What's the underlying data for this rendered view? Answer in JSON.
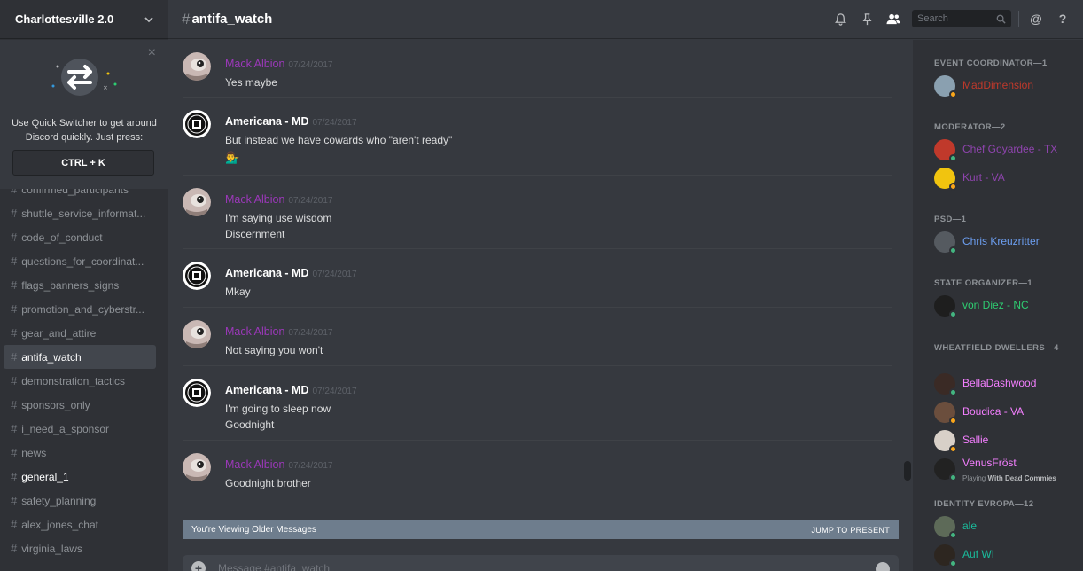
{
  "server": {
    "name": "Charlottesville 2.0"
  },
  "quick_switcher": {
    "text": "Use Quick Switcher to get around Discord quickly. Just press:",
    "shortcut": "CTRL + K"
  },
  "channels": [
    {
      "name": "confirmed_participants",
      "active": false,
      "unread": false
    },
    {
      "name": "shuttle_service_informat...",
      "active": false,
      "unread": false
    },
    {
      "name": "code_of_conduct",
      "active": false,
      "unread": false
    },
    {
      "name": "questions_for_coordinat...",
      "active": false,
      "unread": false
    },
    {
      "name": "flags_banners_signs",
      "active": false,
      "unread": false
    },
    {
      "name": "promotion_and_cyberstr...",
      "active": false,
      "unread": false
    },
    {
      "name": "gear_and_attire",
      "active": false,
      "unread": false
    },
    {
      "name": "antifa_watch",
      "active": true,
      "unread": false
    },
    {
      "name": "demonstration_tactics",
      "active": false,
      "unread": false
    },
    {
      "name": "sponsors_only",
      "active": false,
      "unread": false
    },
    {
      "name": "i_need_a_sponsor",
      "active": false,
      "unread": false
    },
    {
      "name": "news",
      "active": false,
      "unread": false
    },
    {
      "name": "general_1",
      "active": false,
      "unread": true
    },
    {
      "name": "safety_planning",
      "active": false,
      "unread": false
    },
    {
      "name": "alex_jones_chat",
      "active": false,
      "unread": false
    },
    {
      "name": "virginia_laws",
      "active": false,
      "unread": false
    }
  ],
  "channel_header": {
    "hash": "#",
    "name": "antifa_watch"
  },
  "search": {
    "placeholder": "Search"
  },
  "messages": [
    {
      "author": "Mack Albion",
      "author_color": "purple",
      "timestamp": "07/24/2017",
      "avatar": "mack",
      "lines": [
        "Yes maybe"
      ]
    },
    {
      "author": "Americana - MD",
      "author_color": "white",
      "timestamp": "07/24/2017",
      "avatar": "americana",
      "lines": [
        "But instead we have cowards who \"aren't ready\""
      ],
      "emoji": "💁‍♂"
    },
    {
      "author": "Mack Albion",
      "author_color": "purple",
      "timestamp": "07/24/2017",
      "avatar": "mack",
      "lines": [
        "I'm saying use wisdom",
        "Discernment"
      ]
    },
    {
      "author": "Americana - MD",
      "author_color": "white",
      "timestamp": "07/24/2017",
      "avatar": "americana",
      "lines": [
        "Mkay"
      ]
    },
    {
      "author": "Mack Albion",
      "author_color": "purple",
      "timestamp": "07/24/2017",
      "avatar": "mack",
      "lines": [
        "Not saying you won't"
      ]
    },
    {
      "author": "Americana - MD",
      "author_color": "white",
      "timestamp": "07/24/2017",
      "avatar": "americana",
      "lines": [
        "I'm going to sleep now",
        "Goodnight"
      ]
    },
    {
      "author": "Mack Albion",
      "author_color": "purple",
      "timestamp": "07/24/2017",
      "avatar": "mack",
      "lines": [
        "Goodnight brother"
      ]
    }
  ],
  "older_bar": {
    "text": "You're Viewing Older Messages",
    "jump": "JUMP TO PRESENT"
  },
  "composer": {
    "placeholder": "Message #antifa_watch"
  },
  "member_groups": [
    {
      "title": "EVENT COORDINATOR—1",
      "members": [
        {
          "name": "MadDimension",
          "color": "#c0392b",
          "status": "orange",
          "avatar": "#8aa0b0"
        }
      ]
    },
    {
      "title": "MODERATOR—2",
      "members": [
        {
          "name": "Chef Goyardee - TX",
          "color": "#8e44ad",
          "status": "green",
          "avatar": "#c0392b"
        },
        {
          "name": "Kurt - VA",
          "color": "#8e44ad",
          "status": "orange",
          "avatar": "#f1c40f"
        }
      ]
    },
    {
      "title": "PSD—1",
      "members": [
        {
          "name": "Chris Kreuzritter",
          "color": "#6c9ef0",
          "status": "green",
          "avatar": "#555a60"
        }
      ]
    },
    {
      "title": "STATE ORGANIZER—1",
      "members": [
        {
          "name": "von Diez - NC",
          "color": "#2ecc71",
          "status": "green",
          "avatar": "#1e1e1e"
        }
      ]
    },
    {
      "title": "WHEATFIELD DWELLERS—4",
      "members": [
        {
          "name": "BellaDashwood",
          "color": "#f47fff",
          "status": "green",
          "avatar": "#3a2a25",
          "activity": null
        },
        {
          "name": "Boudica - VA",
          "color": "#f47fff",
          "status": "orange",
          "avatar": "#6b4e3d",
          "activity": null
        },
        {
          "name": "Sallie",
          "color": "#f47fff",
          "status": "orange",
          "avatar": "#d8d0c8",
          "activity": null
        },
        {
          "name": "VenusFröst",
          "color": "#f47fff",
          "status": "green",
          "avatar": "#222",
          "activity_prefix": "Playing",
          "activity": "With Dead Commies"
        }
      ]
    },
    {
      "title": "IDENTITY EVROPA—12",
      "members": [
        {
          "name": "ale",
          "color": "#1abc9c",
          "status": "green",
          "avatar": "#5d6a58"
        },
        {
          "name": "Auf WI",
          "color": "#1abc9c",
          "status": "green",
          "avatar": "#2d2620"
        }
      ]
    }
  ]
}
